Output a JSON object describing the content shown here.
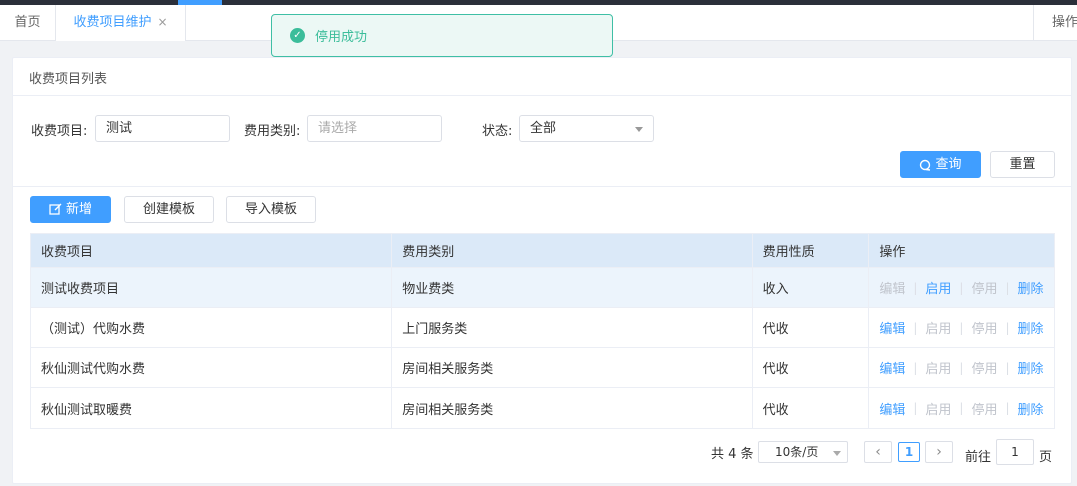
{
  "tabs": {
    "home": "首页",
    "active": "收费项目维护",
    "close": "×",
    "ops": "操作"
  },
  "toast": {
    "message": "停用成功",
    "icon": "check-circle-icon"
  },
  "panel": {
    "title": "收费项目列表"
  },
  "filters": {
    "item_label": "收费项目:",
    "item_value": "测试",
    "category_label": "费用类别:",
    "category_placeholder": "请选择",
    "status_label": "状态:",
    "status_value": "全部"
  },
  "actions": {
    "query": "查询",
    "reset": "重置",
    "add": "新增",
    "create_template": "创建模板",
    "import_template": "导入模板"
  },
  "table": {
    "headers": [
      "收费项目",
      "费用类别",
      "费用性质",
      "操作"
    ],
    "op_labels": [
      "编辑",
      "启用",
      "停用",
      "删除"
    ],
    "rows": [
      {
        "item": "测试收费项目",
        "category": "物业费类",
        "nature": "收入",
        "edit_enabled": false,
        "enable_enabled": true,
        "disable_enabled": false
      },
      {
        "item": "（测试）代购水费",
        "category": "上门服务类",
        "nature": "代收",
        "edit_enabled": true,
        "enable_enabled": false,
        "disable_enabled": false
      },
      {
        "item": "秋仙测试代购水费",
        "category": "房间相关服务类",
        "nature": "代收",
        "edit_enabled": true,
        "enable_enabled": false,
        "disable_enabled": false
      },
      {
        "item": "秋仙测试取暖费",
        "category": "房间相关服务类",
        "nature": "代收",
        "edit_enabled": true,
        "enable_enabled": false,
        "disable_enabled": false
      }
    ]
  },
  "pager": {
    "total": "共 4 条",
    "page_size": "10条/页",
    "current": "1",
    "goto_label": "前往",
    "goto_value": "1",
    "page_suffix": "页",
    "prev": "‹",
    "next": "›"
  },
  "colors": {
    "primary": "#409eff",
    "success": "#3bbd9a",
    "disabled": "#c0c4cc",
    "header_bg": "#dbe9f8"
  }
}
